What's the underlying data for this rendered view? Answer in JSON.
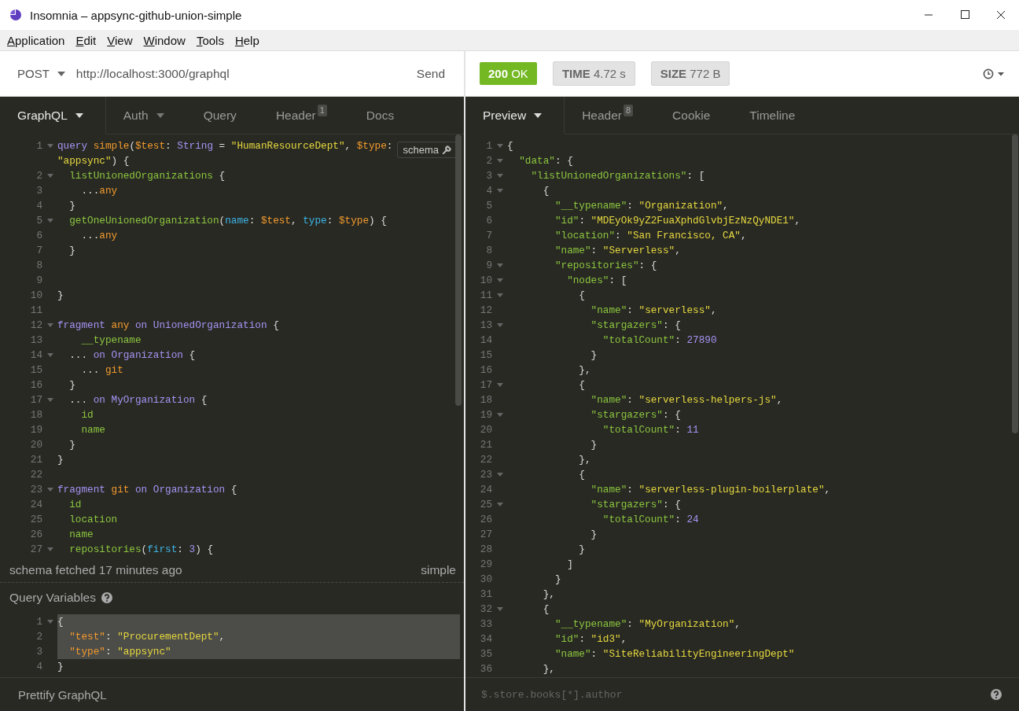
{
  "window": {
    "title": "Insomnia – appsync-github-union-simple"
  },
  "menu": [
    {
      "mnemonic": "A",
      "rest": "pplication"
    },
    {
      "mnemonic": "E",
      "rest": "dit"
    },
    {
      "mnemonic": "V",
      "rest": "iew"
    },
    {
      "mnemonic": "W",
      "rest": "indow"
    },
    {
      "mnemonic": "T",
      "rest": "ools"
    },
    {
      "mnemonic": "H",
      "rest": "elp"
    }
  ],
  "request": {
    "method": "POST",
    "url": "http://localhost:3000/graphql",
    "send": "Send",
    "tabs": [
      {
        "label": "GraphQL",
        "selected": true,
        "dropdown": true
      },
      {
        "label": "Auth",
        "selected": false,
        "dropdown": true
      },
      {
        "label": "Query",
        "selected": false,
        "dropdown": false
      },
      {
        "label": "Header",
        "selected": false,
        "dropdown": false,
        "count": "1"
      },
      {
        "label": "Docs",
        "selected": false,
        "dropdown": false
      }
    ],
    "schema_button": "schema",
    "editor": [
      {
        "n": "1",
        "fold": true,
        "tokens": [
          {
            "kind": "kw",
            "text": "query "
          },
          {
            "kind": "def",
            "text": "simple"
          },
          {
            "kind": "p",
            "text": "("
          },
          {
            "kind": "def",
            "text": "$test"
          },
          {
            "kind": "p",
            "text": ": "
          },
          {
            "kind": "kw",
            "text": "String"
          },
          {
            "kind": "p",
            "text": " = "
          },
          {
            "kind": "str",
            "text": "\"HumanResourceDept\""
          },
          {
            "kind": "p",
            "text": ", "
          },
          {
            "kind": "def",
            "text": "$type"
          },
          {
            "kind": "p",
            "text": ":"
          }
        ]
      },
      {
        "fold": false,
        "tokens": [
          {
            "kind": "str",
            "text": "\"appsync\""
          },
          {
            "kind": "p",
            "text": ") {"
          }
        ]
      },
      {
        "n": "2",
        "fold": true,
        "tokens": [
          {
            "kind": "field",
            "text": "  listUnionedOrganizations"
          },
          {
            "kind": "p",
            "text": " {"
          }
        ]
      },
      {
        "n": "3",
        "fold": false,
        "tokens": [
          {
            "kind": "p",
            "text": "    ..."
          },
          {
            "kind": "def",
            "text": "any"
          }
        ]
      },
      {
        "n": "4",
        "fold": false,
        "tokens": [
          {
            "kind": "p",
            "text": "  }"
          }
        ]
      },
      {
        "n": "5",
        "fold": true,
        "tokens": [
          {
            "kind": "field",
            "text": "  getOneUnionedOrganization"
          },
          {
            "kind": "p",
            "text": "("
          },
          {
            "kind": "arg",
            "text": "name"
          },
          {
            "kind": "p",
            "text": ": "
          },
          {
            "kind": "def",
            "text": "$test"
          },
          {
            "kind": "p",
            "text": ", "
          },
          {
            "kind": "arg",
            "text": "type"
          },
          {
            "kind": "p",
            "text": ": "
          },
          {
            "kind": "def",
            "text": "$type"
          },
          {
            "kind": "p",
            "text": ") {"
          }
        ]
      },
      {
        "n": "6",
        "fold": false,
        "tokens": [
          {
            "kind": "p",
            "text": "    ..."
          },
          {
            "kind": "def",
            "text": "any"
          }
        ]
      },
      {
        "n": "7",
        "fold": false,
        "tokens": [
          {
            "kind": "p",
            "text": "  }"
          }
        ]
      },
      {
        "n": "8",
        "fold": false
      },
      {
        "n": "9",
        "fold": false
      },
      {
        "n": "10",
        "fold": false,
        "tokens": [
          {
            "kind": "p",
            "text": "}"
          }
        ]
      },
      {
        "n": "11",
        "fold": false
      },
      {
        "n": "12",
        "fold": true,
        "tokens": [
          {
            "kind": "kw",
            "text": "fragment "
          },
          {
            "kind": "def",
            "text": "any "
          },
          {
            "kind": "kw",
            "text": "on UnionedOrganization"
          },
          {
            "kind": "p",
            "text": " {"
          }
        ]
      },
      {
        "n": "13",
        "fold": false,
        "tokens": [
          {
            "kind": "field",
            "text": "    __typename"
          }
        ]
      },
      {
        "n": "14",
        "fold": true,
        "tokens": [
          {
            "kind": "p",
            "text": "  ... "
          },
          {
            "kind": "kw",
            "text": "on Organization"
          },
          {
            "kind": "p",
            "text": " {"
          }
        ]
      },
      {
        "n": "15",
        "fold": false,
        "tokens": [
          {
            "kind": "p",
            "text": "    ... "
          },
          {
            "kind": "def",
            "text": "git"
          }
        ]
      },
      {
        "n": "16",
        "fold": false,
        "tokens": [
          {
            "kind": "p",
            "text": "  }"
          }
        ]
      },
      {
        "n": "17",
        "fold": true,
        "tokens": [
          {
            "kind": "p",
            "text": "  ... "
          },
          {
            "kind": "kw",
            "text": "on MyOrganization"
          },
          {
            "kind": "p",
            "text": " {"
          }
        ]
      },
      {
        "n": "18",
        "fold": false,
        "tokens": [
          {
            "kind": "field",
            "text": "    id"
          }
        ]
      },
      {
        "n": "19",
        "fold": false,
        "tokens": [
          {
            "kind": "field",
            "text": "    name"
          }
        ]
      },
      {
        "n": "20",
        "fold": false,
        "tokens": [
          {
            "kind": "p",
            "text": "  }"
          }
        ]
      },
      {
        "n": "21",
        "fold": false,
        "tokens": [
          {
            "kind": "p",
            "text": "}"
          }
        ]
      },
      {
        "n": "22",
        "fold": false
      },
      {
        "n": "23",
        "fold": true,
        "tokens": [
          {
            "kind": "kw",
            "text": "fragment "
          },
          {
            "kind": "def",
            "text": "git "
          },
          {
            "kind": "kw",
            "text": "on Organization"
          },
          {
            "kind": "p",
            "text": " {"
          }
        ]
      },
      {
        "n": "24",
        "fold": false,
        "tokens": [
          {
            "kind": "field",
            "text": "  id"
          }
        ]
      },
      {
        "n": "25",
        "fold": false,
        "tokens": [
          {
            "kind": "field",
            "text": "  location"
          }
        ]
      },
      {
        "n": "26",
        "fold": false,
        "tokens": [
          {
            "kind": "field",
            "text": "  name"
          }
        ]
      },
      {
        "n": "27",
        "fold": true,
        "tokens": [
          {
            "kind": "field",
            "text": "  repositories"
          },
          {
            "kind": "p",
            "text": "("
          },
          {
            "kind": "arg",
            "text": "first"
          },
          {
            "kind": "p",
            "text": ": "
          },
          {
            "kind": "num",
            "text": "3"
          },
          {
            "kind": "p",
            "text": ") {"
          }
        ]
      }
    ],
    "schema_status": "schema fetched 17 minutes ago",
    "operation": "simple",
    "variables_title": "Query Variables",
    "variables": [
      {
        "n": "1",
        "fold": true,
        "selected": true,
        "tokens": [
          {
            "kind": "p",
            "text": "{"
          }
        ]
      },
      {
        "n": "2",
        "fold": false,
        "selected": true,
        "tokens": [
          {
            "kind": "def",
            "text": "  \"test\""
          },
          {
            "kind": "p",
            "text": ": "
          },
          {
            "kind": "str",
            "text": "\"ProcurementDept\""
          },
          {
            "kind": "p",
            "text": ","
          }
        ]
      },
      {
        "n": "3",
        "fold": false,
        "selected": true,
        "tokens": [
          {
            "kind": "def",
            "text": "  \"type\""
          },
          {
            "kind": "p",
            "text": ": "
          },
          {
            "kind": "str",
            "text": "\"appsync\""
          }
        ]
      },
      {
        "n": "4",
        "fold": false,
        "selected": false,
        "tokens": [
          {
            "kind": "p",
            "text": "}"
          }
        ]
      }
    ],
    "prettify": "Prettify GraphQL"
  },
  "response": {
    "status": "**200** OK",
    "time": "**TIME** 4.72 s",
    "size": "**SIZE** 772 B",
    "tabs": [
      {
        "label": "Preview",
        "selected": true,
        "dropdown": true
      },
      {
        "label": "Header",
        "selected": false,
        "dropdown": false,
        "count": "8"
      },
      {
        "label": "Cookie",
        "selected": false,
        "dropdown": false
      },
      {
        "label": "Timeline",
        "selected": false,
        "dropdown": false
      }
    ],
    "body": [
      {
        "n": "1",
        "fold": true,
        "tokens": [
          {
            "kind": "p",
            "text": "{"
          }
        ]
      },
      {
        "n": "2",
        "fold": true,
        "tokens": [
          {
            "kind": "key",
            "text": "  \"data\""
          },
          {
            "kind": "p",
            "text": ": {"
          }
        ]
      },
      {
        "n": "3",
        "fold": true,
        "tokens": [
          {
            "kind": "key",
            "text": "    \"listUnionedOrganizations\""
          },
          {
            "kind": "p",
            "text": ": ["
          }
        ]
      },
      {
        "n": "4",
        "fold": true,
        "tokens": [
          {
            "kind": "p",
            "text": "      {"
          }
        ]
      },
      {
        "n": "5",
        "fold": false,
        "tokens": [
          {
            "kind": "key",
            "text": "        \"__typename\""
          },
          {
            "kind": "p",
            "text": ": "
          },
          {
            "kind": "str",
            "text": "\"Organization\""
          },
          {
            "kind": "p",
            "text": ","
          }
        ]
      },
      {
        "n": "6",
        "fold": false,
        "tokens": [
          {
            "kind": "key",
            "text": "        \"id\""
          },
          {
            "kind": "p",
            "text": ": "
          },
          {
            "kind": "str",
            "text": "\"MDEyOk9yZ2FuaXphdGlvbjEzNzQyNDE1\""
          },
          {
            "kind": "p",
            "text": ","
          }
        ]
      },
      {
        "n": "7",
        "fold": false,
        "tokens": [
          {
            "kind": "key",
            "text": "        \"location\""
          },
          {
            "kind": "p",
            "text": ": "
          },
          {
            "kind": "str",
            "text": "\"San Francisco, CA\""
          },
          {
            "kind": "p",
            "text": ","
          }
        ]
      },
      {
        "n": "8",
        "fold": false,
        "tokens": [
          {
            "kind": "key",
            "text": "        \"name\""
          },
          {
            "kind": "p",
            "text": ": "
          },
          {
            "kind": "str",
            "text": "\"Serverless\""
          },
          {
            "kind": "p",
            "text": ","
          }
        ]
      },
      {
        "n": "9",
        "fold": true,
        "tokens": [
          {
            "kind": "key",
            "text": "        \"repositories\""
          },
          {
            "kind": "p",
            "text": ": {"
          }
        ]
      },
      {
        "n": "10",
        "fold": true,
        "tokens": [
          {
            "kind": "key",
            "text": "          \"nodes\""
          },
          {
            "kind": "p",
            "text": ": ["
          }
        ]
      },
      {
        "n": "11",
        "fold": true,
        "tokens": [
          {
            "kind": "p",
            "text": "            {"
          }
        ]
      },
      {
        "n": "12",
        "fold": false,
        "tokens": [
          {
            "kind": "key",
            "text": "              \"name\""
          },
          {
            "kind": "p",
            "text": ": "
          },
          {
            "kind": "str",
            "text": "\"serverless\""
          },
          {
            "kind": "p",
            "text": ","
          }
        ]
      },
      {
        "n": "13",
        "fold": true,
        "tokens": [
          {
            "kind": "key",
            "text": "              \"stargazers\""
          },
          {
            "kind": "p",
            "text": ": {"
          }
        ]
      },
      {
        "n": "14",
        "fold": false,
        "tokens": [
          {
            "kind": "key",
            "text": "                \"totalCount\""
          },
          {
            "kind": "p",
            "text": ": "
          },
          {
            "kind": "num",
            "text": "27890"
          }
        ]
      },
      {
        "n": "15",
        "fold": false,
        "tokens": [
          {
            "kind": "p",
            "text": "              }"
          }
        ]
      },
      {
        "n": "16",
        "fold": false,
        "tokens": [
          {
            "kind": "p",
            "text": "            },"
          }
        ]
      },
      {
        "n": "17",
        "fold": true,
        "tokens": [
          {
            "kind": "p",
            "text": "            {"
          }
        ]
      },
      {
        "n": "18",
        "fold": false,
        "tokens": [
          {
            "kind": "key",
            "text": "              \"name\""
          },
          {
            "kind": "p",
            "text": ": "
          },
          {
            "kind": "str",
            "text": "\"serverless-helpers-js\""
          },
          {
            "kind": "p",
            "text": ","
          }
        ]
      },
      {
        "n": "19",
        "fold": true,
        "tokens": [
          {
            "kind": "key",
            "text": "              \"stargazers\""
          },
          {
            "kind": "p",
            "text": ": {"
          }
        ]
      },
      {
        "n": "20",
        "fold": false,
        "tokens": [
          {
            "kind": "key",
            "text": "                \"totalCount\""
          },
          {
            "kind": "p",
            "text": ": "
          },
          {
            "kind": "num",
            "text": "11"
          }
        ]
      },
      {
        "n": "21",
        "fold": false,
        "tokens": [
          {
            "kind": "p",
            "text": "              }"
          }
        ]
      },
      {
        "n": "22",
        "fold": false,
        "tokens": [
          {
            "kind": "p",
            "text": "            },"
          }
        ]
      },
      {
        "n": "23",
        "fold": true,
        "tokens": [
          {
            "kind": "p",
            "text": "            {"
          }
        ]
      },
      {
        "n": "24",
        "fold": false,
        "tokens": [
          {
            "kind": "key",
            "text": "              \"name\""
          },
          {
            "kind": "p",
            "text": ": "
          },
          {
            "kind": "str",
            "text": "\"serverless-plugin-boilerplate\""
          },
          {
            "kind": "p",
            "text": ","
          }
        ]
      },
      {
        "n": "25",
        "fold": true,
        "tokens": [
          {
            "kind": "key",
            "text": "              \"stargazers\""
          },
          {
            "kind": "p",
            "text": ": {"
          }
        ]
      },
      {
        "n": "26",
        "fold": false,
        "tokens": [
          {
            "kind": "key",
            "text": "                \"totalCount\""
          },
          {
            "kind": "p",
            "text": ": "
          },
          {
            "kind": "num",
            "text": "24"
          }
        ]
      },
      {
        "n": "27",
        "fold": false,
        "tokens": [
          {
            "kind": "p",
            "text": "              }"
          }
        ]
      },
      {
        "n": "28",
        "fold": false,
        "tokens": [
          {
            "kind": "p",
            "text": "            }"
          }
        ]
      },
      {
        "n": "29",
        "fold": false,
        "tokens": [
          {
            "kind": "p",
            "text": "          ]"
          }
        ]
      },
      {
        "n": "30",
        "fold": false,
        "tokens": [
          {
            "kind": "p",
            "text": "        }"
          }
        ]
      },
      {
        "n": "31",
        "fold": false,
        "tokens": [
          {
            "kind": "p",
            "text": "      },"
          }
        ]
      },
      {
        "n": "32",
        "fold": true,
        "tokens": [
          {
            "kind": "p",
            "text": "      {"
          }
        ]
      },
      {
        "n": "33",
        "fold": false,
        "tokens": [
          {
            "kind": "key",
            "text": "        \"__typename\""
          },
          {
            "kind": "p",
            "text": ": "
          },
          {
            "kind": "str",
            "text": "\"MyOrganization\""
          },
          {
            "kind": "p",
            "text": ","
          }
        ]
      },
      {
        "n": "34",
        "fold": false,
        "tokens": [
          {
            "kind": "key",
            "text": "        \"id\""
          },
          {
            "kind": "p",
            "text": ": "
          },
          {
            "kind": "str",
            "text": "\"id3\""
          },
          {
            "kind": "p",
            "text": ","
          }
        ]
      },
      {
        "n": "35",
        "fold": false,
        "tokens": [
          {
            "kind": "key",
            "text": "        \"name\""
          },
          {
            "kind": "p",
            "text": ": "
          },
          {
            "kind": "str",
            "text": "\"SiteReliabilityEngineeringDept\""
          }
        ]
      },
      {
        "n": "36",
        "fold": false,
        "tokens": [
          {
            "kind": "p",
            "text": "      },"
          }
        ]
      }
    ],
    "filter": {
      "placeholder": "$.store.books[*].author"
    }
  }
}
